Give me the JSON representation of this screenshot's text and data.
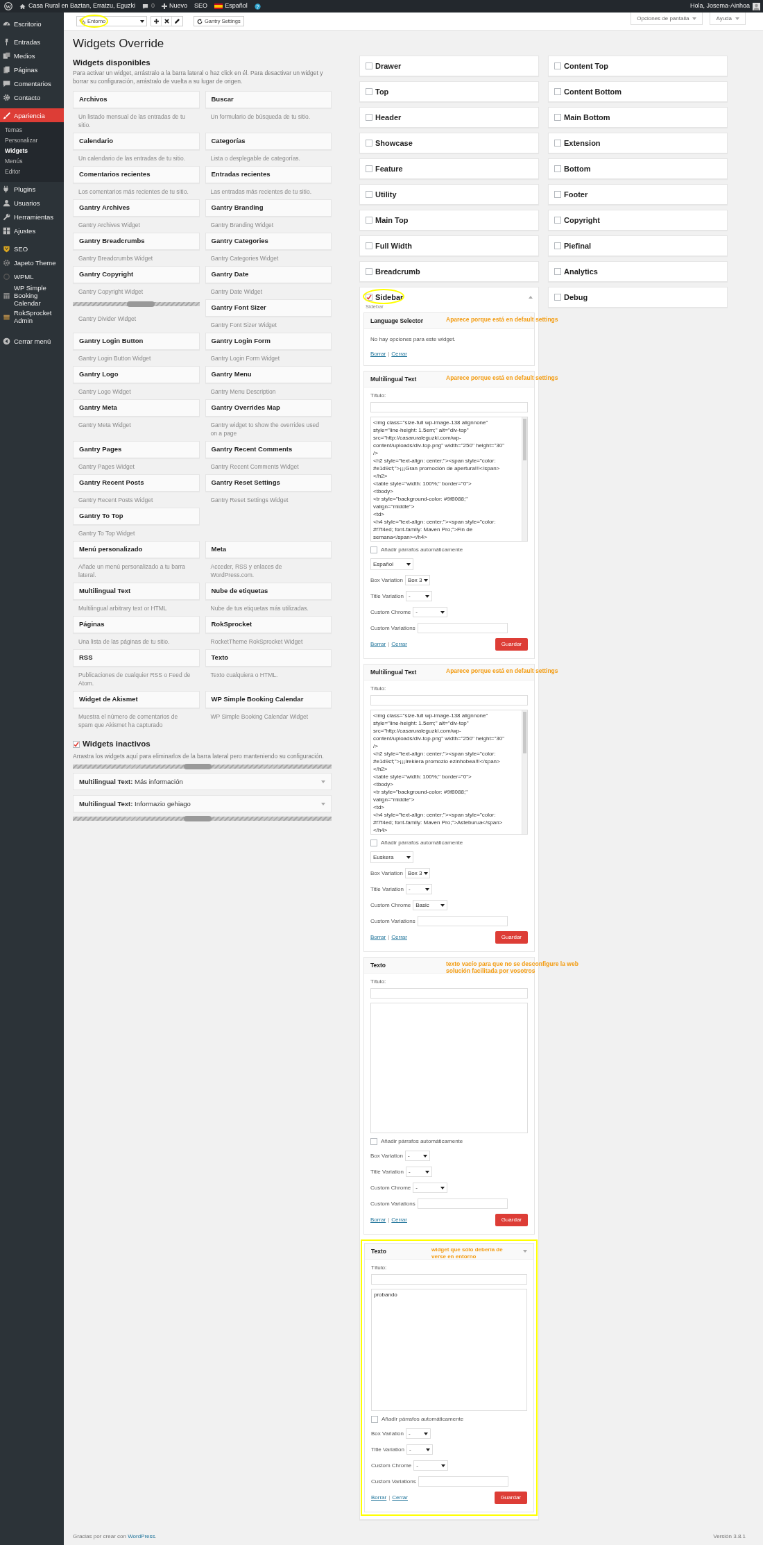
{
  "admin_bar": {
    "site": "Casa Rural en Baztan, Erratzu, Eguzki",
    "comments": "0",
    "new": "Nuevo",
    "seo": "SEO",
    "language": "Español",
    "greeting": "Hola, Josema-Ainhoa"
  },
  "menu": [
    {
      "label": "Escritorio",
      "selected": false
    },
    {
      "label": "Entradas",
      "selected": false
    },
    {
      "label": "Medios",
      "selected": false
    },
    {
      "label": "Páginas",
      "selected": false
    },
    {
      "label": "Comentarios",
      "selected": false
    },
    {
      "label": "Contacto",
      "selected": false
    },
    {
      "label": "Apariencia",
      "selected": true,
      "children": [
        {
          "label": "Temas",
          "selected": false
        },
        {
          "label": "Personalizar",
          "selected": false
        },
        {
          "label": "Widgets",
          "selected": true
        },
        {
          "label": "Menús",
          "selected": false
        },
        {
          "label": "Editor",
          "selected": false
        }
      ]
    },
    {
      "label": "Plugins",
      "selected": false
    },
    {
      "label": "Usuarios",
      "selected": false
    },
    {
      "label": "Herramientas",
      "selected": false
    },
    {
      "label": "Ajustes",
      "selected": false
    },
    {
      "label": "SEO",
      "selected": false
    },
    {
      "label": "Japeto Theme",
      "selected": false
    },
    {
      "label": "WPML",
      "selected": false
    },
    {
      "label": "WP Simple Booking Calendar",
      "selected": false
    },
    {
      "label": "RokSprocket Admin",
      "selected": false
    },
    {
      "label": "Cerrar menú",
      "selected": false
    }
  ],
  "toolbar": {
    "override": "Entorno",
    "highlighted": true,
    "settings": "Gantry Settings",
    "screen_options": "Opciones de pantalla",
    "help": "Ayuda"
  },
  "title": "Widgets Override",
  "available": {
    "heading": "Widgets disponibles",
    "description": "Para activar un widget, arrástralo a la barra lateral o haz click en él. Para desactivar un widget y borrar su configuración, arrástralo de vuelta a su lugar de origen.",
    "rows": [
      [
        {
          "kind": "widget",
          "title": "Archivos",
          "description": "Un listado mensual de las entradas de tu sitio."
        },
        {
          "kind": "widget",
          "title": "Buscar",
          "description": "Un formulario de búsqueda de tu sitio."
        }
      ],
      [
        {
          "kind": "widget",
          "title": "Calendario",
          "description": "Un calendario de las entradas de tu sitio."
        },
        {
          "kind": "widget",
          "title": "Categorías",
          "description": "Lista o desplegable de categorías."
        }
      ],
      [
        {
          "kind": "widget",
          "title": "Comentarios recientes",
          "description": "Los comentarios más recientes de tu sitio."
        },
        {
          "kind": "widget",
          "title": "Entradas recientes",
          "description": "Las entradas más recientes de tu sitio."
        }
      ],
      [
        {
          "kind": "widget",
          "title": "Gantry Archives",
          "description": "Gantry Archives Widget"
        },
        {
          "kind": "widget",
          "title": "Gantry Branding",
          "description": "Gantry Branding Widget"
        }
      ],
      [
        {
          "kind": "widget",
          "title": "Gantry Breadcrumbs",
          "description": "Gantry Breadcrumbs Widget"
        },
        {
          "kind": "widget",
          "title": "Gantry Categories",
          "description": "Gantry Categories Widget"
        }
      ],
      [
        {
          "kind": "widget",
          "title": "Gantry Copyright",
          "description": "Gantry Copyright Widget"
        },
        {
          "kind": "widget",
          "title": "Gantry Date",
          "description": "Gantry Date Widget"
        }
      ],
      [
        {
          "kind": "divider",
          "description": "Gantry Divider Widget"
        },
        {
          "kind": "widget",
          "title": "Gantry Font Sizer",
          "description": "Gantry Font Sizer Widget"
        }
      ],
      [
        {
          "kind": "widget",
          "title": "Gantry Login Button",
          "description": "Gantry Login Button Widget"
        },
        {
          "kind": "widget",
          "title": "Gantry Login Form",
          "description": "Gantry Login Form Widget"
        }
      ],
      [
        {
          "kind": "widget",
          "title": "Gantry Logo",
          "description": "Gantry Logo Widget"
        },
        {
          "kind": "widget",
          "title": "Gantry Menu",
          "description": "Gantry Menu Description"
        }
      ],
      [
        {
          "kind": "widget",
          "title": "Gantry Meta",
          "description": "Gantry Meta Widget"
        },
        {
          "kind": "widget",
          "title": "Gantry Overrides Map",
          "description": "Gantry widget to show the overrides used on a page"
        }
      ],
      [
        {
          "kind": "widget",
          "title": "Gantry Pages",
          "description": "Gantry Pages Widget"
        },
        {
          "kind": "widget",
          "title": "Gantry Recent Comments",
          "description": "Gantry Recent Comments Widget"
        }
      ],
      [
        {
          "kind": "widget",
          "title": "Gantry Recent Posts",
          "description": "Gantry Recent Posts Widget"
        },
        {
          "kind": "widget",
          "title": "Gantry Reset Settings",
          "description": "Gantry Reset Settings Widget"
        }
      ],
      [
        {
          "kind": "widget",
          "title": "Gantry To Top",
          "description": "Gantry To Top Widget"
        }
      ],
      [
        {
          "kind": "widget",
          "title": "Menú personalizado",
          "description": "Añade un menú personalizado a tu barra lateral."
        },
        {
          "kind": "widget",
          "title": "Meta",
          "description": "Acceder, RSS y enlaces de WordPress.com."
        }
      ],
      [
        {
          "kind": "widget",
          "title": "Multilingual Text",
          "description": "Multilingual arbitrary text or HTML"
        },
        {
          "kind": "widget",
          "title": "Nube de etiquetas",
          "description": "Nube de tus etiquetas más utilizadas."
        }
      ],
      [
        {
          "kind": "widget",
          "title": "Páginas",
          "description": "Una lista de las páginas de tu sitio."
        },
        {
          "kind": "widget",
          "title": "RokSprocket",
          "description": "RocketTheme RokSprocket Widget"
        }
      ],
      [
        {
          "kind": "widget",
          "title": "RSS",
          "description": "Publicaciones de cualquier RSS o Feed de Atom."
        },
        {
          "kind": "widget",
          "title": "Texto",
          "description": "Texto cualquiera o HTML."
        }
      ],
      [
        {
          "kind": "widget",
          "title": "Widget de Akismet",
          "description": "Muestra el número de comentarios de spam que Akismet ha capturado"
        },
        {
          "kind": "widget",
          "title": "WP Simple Booking Calendar",
          "description": "WP Simple Booking Calendar Widget"
        }
      ]
    ]
  },
  "inactive": {
    "heading": "Widgets inactivos",
    "checked": true,
    "description": "Arrastra los widgets aquí para eliminarlos de la barra lateral pero manteniendo su configuración.",
    "items": [
      {
        "title": "**Multilingual Text:** Más información"
      },
      {
        "title": "**Multilingual Text:** Informazio gehiago"
      }
    ]
  },
  "sidebar_columns": [
    {
      "items": [
        {
          "title": "Drawer",
          "checked": false,
          "expanded": false
        },
        {
          "title": "Top",
          "checked": false,
          "expanded": false
        },
        {
          "title": "Header",
          "checked": false,
          "expanded": false
        },
        {
          "title": "Showcase",
          "checked": false,
          "expanded": false
        },
        {
          "title": "Feature",
          "checked": false,
          "expanded": false
        },
        {
          "title": "Utility",
          "checked": false,
          "expanded": false
        },
        {
          "title": "Main Top",
          "checked": false,
          "expanded": false
        },
        {
          "title": "Full Width",
          "checked": false,
          "expanded": false
        },
        {
          "title": "Breadcrumb",
          "checked": false,
          "expanded": false
        },
        {
          "title": "Sidebar",
          "checked": true,
          "expanded": true,
          "highlighted": true,
          "subtitle": "Sidebar",
          "widgets": [
            {
              "kind": "no_options",
              "title": "Language Selector",
              "note": "Aparece porque está en default settings",
              "message": "No hay opciones para este widget.",
              "delete": "Borrar",
              "separator": "|",
              "close": "Cerrar",
              "highlighted": false
            },
            {
              "kind": "form",
              "title": "Multilingual Text",
              "note": "Aparece porque está en default settings",
              "title_label": "Título:",
              "text": "<img class=\"size-full wp-image-138 alignnone\"\nstyle=\"line-height: 1.5em;\" alt=\"div-top\"\nsrc=\"http://casaruraleguzki.com/wp-\ncontent/uploads/div-top.png\" width=\"250\" height=\"30\"\n/>\n<h2 style=\"text-align: center;\"><span style=\"color:\n#e1d9cf;\">¡¡¡Gran promoción de apertura!!!</span>\n</h2>\n<table style=\"width: 100%;\" border=\"0\">\n<tbody>\n<tr style=\"background-color: #9f8088;\"\nvalign=\"middle\">\n<td>\n<h4 style=\"text-align: center;\"><span style=\"color:\n#f7f4ed; font-family: Maven Pro;\">Fin de\nsemana</span></h4>",
              "auto_p": {
                "label": "Añadir párrafos automáticamente",
                "checked": false
              },
              "language": "Español",
              "fields": [
                {
                  "label": "Box Variation",
                  "value": "Box 3"
                },
                {
                  "label": "Title Variation",
                  "value": "-"
                },
                {
                  "label": "Custom Chrome",
                  "value": "-"
                }
              ],
              "custom_variations": "Custom Variations",
              "delete": "Borrar",
              "separator": "|",
              "close": "Cerrar",
              "save": "Guardar",
              "highlighted": false
            },
            {
              "kind": "form",
              "title": "Multilingual Text",
              "note": "Aparece porque está en default settings",
              "title_label": "Título:",
              "text": "<img class=\"size-full wp-image-138 alignnone\"\nstyle=\"line-height: 1.5em;\" alt=\"div-top\"\nsrc=\"http://casaruraleguzki.com/wp-\ncontent/uploads/div-top.png\" width=\"250\" height=\"30\"\n/>\n<h2 style=\"text-align: center;\"><span style=\"color:\n#e1d9cf;\">¡¡¡Irekiera promozio ezinhobea!!!</span>\n</h2>\n<table style=\"width: 100%;\" border=\"0\">\n<tbody>\n<tr style=\"background-color: #9f8088;\"\nvalign=\"middle\">\n<td>\n<h4 style=\"text-align: center;\"><span style=\"color:\n#f7f4ed; font-family: Maven Pro;\">Asteburua</span>\n</h4>",
              "auto_p": {
                "label": "Añadir párrafos automáticamente",
                "checked": false
              },
              "language": "Euskera",
              "fields": [
                {
                  "label": "Box Variation",
                  "value": "Box 3"
                },
                {
                  "label": "Title Variation",
                  "value": "-"
                },
                {
                  "label": "Custom Chrome",
                  "value": "Basic"
                }
              ],
              "custom_variations": "Custom Variations",
              "delete": "Borrar",
              "separator": "|",
              "close": "Cerrar",
              "save": "Guardar",
              "highlighted": false
            },
            {
              "kind": "form",
              "title": "Texto",
              "note": "texto vacío para que no se desconfigure la web solución facilitada por vosotros",
              "title_label": "Título:",
              "auto_p": {
                "label": "Añadir párrafos automáticamente",
                "checked": false
              },
              "fields": [
                {
                  "label": "Box Variation",
                  "value": "-"
                },
                {
                  "label": "Title Variation",
                  "value": "-"
                },
                {
                  "label": "Custom Chrome",
                  "value": "-"
                }
              ],
              "custom_variations": "Custom Variations",
              "delete": "Borrar",
              "separator": "|",
              "close": "Cerrar",
              "save": "Guardar",
              "highlighted": false
            },
            {
              "kind": "form",
              "title": "Texto",
              "note": "widget que sólo debería de verse en entorno",
              "title_label": "Título:",
              "text": "probando",
              "auto_p": {
                "label": "Añadir párrafos automáticamente",
                "checked": false
              },
              "fields": [
                {
                  "label": "Box Variation",
                  "value": "-"
                },
                {
                  "label": "Title Variation",
                  "value": "-"
                },
                {
                  "label": "Custom Chrome",
                  "value": "-"
                }
              ],
              "custom_variations": "Custom Variations",
              "delete": "Borrar",
              "separator": "|",
              "close": "Cerrar",
              "save": "Guardar",
              "highlighted": true,
              "arrow": true
            }
          ]
        }
      ]
    },
    {
      "items": [
        {
          "title": "Content Top",
          "checked": false,
          "expanded": false
        },
        {
          "title": "Content Bottom",
          "checked": false,
          "expanded": false
        },
        {
          "title": "Main Bottom",
          "checked": false,
          "expanded": false
        },
        {
          "title": "Extension",
          "checked": false,
          "expanded": false
        },
        {
          "title": "Bottom",
          "checked": false,
          "expanded": false
        },
        {
          "title": "Footer",
          "checked": false,
          "expanded": false
        },
        {
          "title": "Copyright",
          "checked": false,
          "expanded": false
        },
        {
          "title": "Piefinal",
          "checked": false,
          "expanded": false
        },
        {
          "title": "Analytics",
          "checked": false,
          "expanded": false
        },
        {
          "title": "Debug",
          "checked": false,
          "expanded": false
        }
      ]
    }
  ],
  "footer": {
    "thanks": "Gracias por crear con",
    "link": "WordPress",
    "end": ".",
    "version": "Versión 3.8.1"
  }
}
